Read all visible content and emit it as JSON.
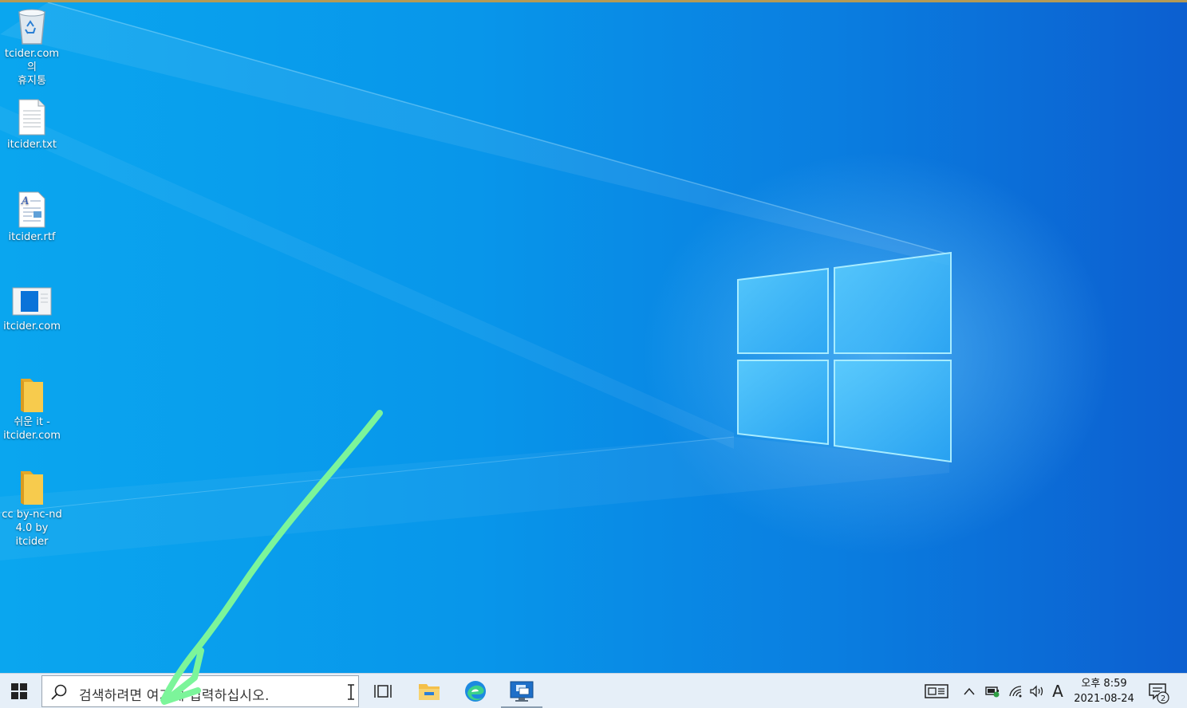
{
  "desktop": {
    "icons": [
      {
        "label": "tcider.com의\n휴지통",
        "icon": "recycle-bin-icon"
      },
      {
        "label": "itcider.txt",
        "icon": "text-file-icon"
      },
      {
        "label": "itcider.rtf",
        "icon": "rtf-file-icon"
      },
      {
        "label": "itcider.com",
        "icon": "web-shortcut-icon"
      },
      {
        "label": "쉬운 it -\nitcider.com",
        "icon": "folder-icon"
      },
      {
        "label": "cc by-nc-nd\n4.0 by itcider",
        "icon": "folder-icon"
      }
    ],
    "annotation_color": "#7cf59a"
  },
  "taskbar": {
    "search_placeholder": "검색하려면 여기에 입력하십시오.",
    "pinned": [
      "task-view-icon",
      "file-explorer-icon",
      "edge-icon",
      "remote-desktop-icon"
    ],
    "tray": {
      "ime_label": "A",
      "time": "오후 8:59",
      "date": "2021-08-24",
      "notification_count": "2"
    }
  },
  "colors": {
    "desktop_blue": "#0896ea",
    "taskbar_bg": "#e6eff8",
    "folder_yellow": "#f7cb4d"
  }
}
